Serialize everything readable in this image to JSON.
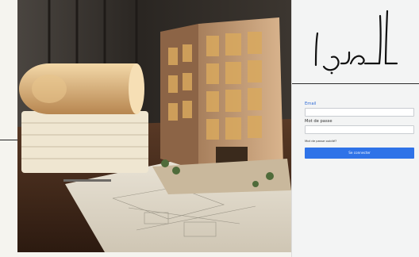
{
  "brand": {
    "logo_text": "العمران"
  },
  "form": {
    "email_label": "Email",
    "email_value": "",
    "password_label": "Mot de passe",
    "password_value": "",
    "forgot_link": "Mot de passe oublié?",
    "submit_label": "Se connecter"
  },
  "colors": {
    "accent": "#2f73e8",
    "panel_bg": "#f3f4f4",
    "page_bg": "#f5f4ef"
  },
  "hero": {
    "icon": "architecture-illustration"
  }
}
